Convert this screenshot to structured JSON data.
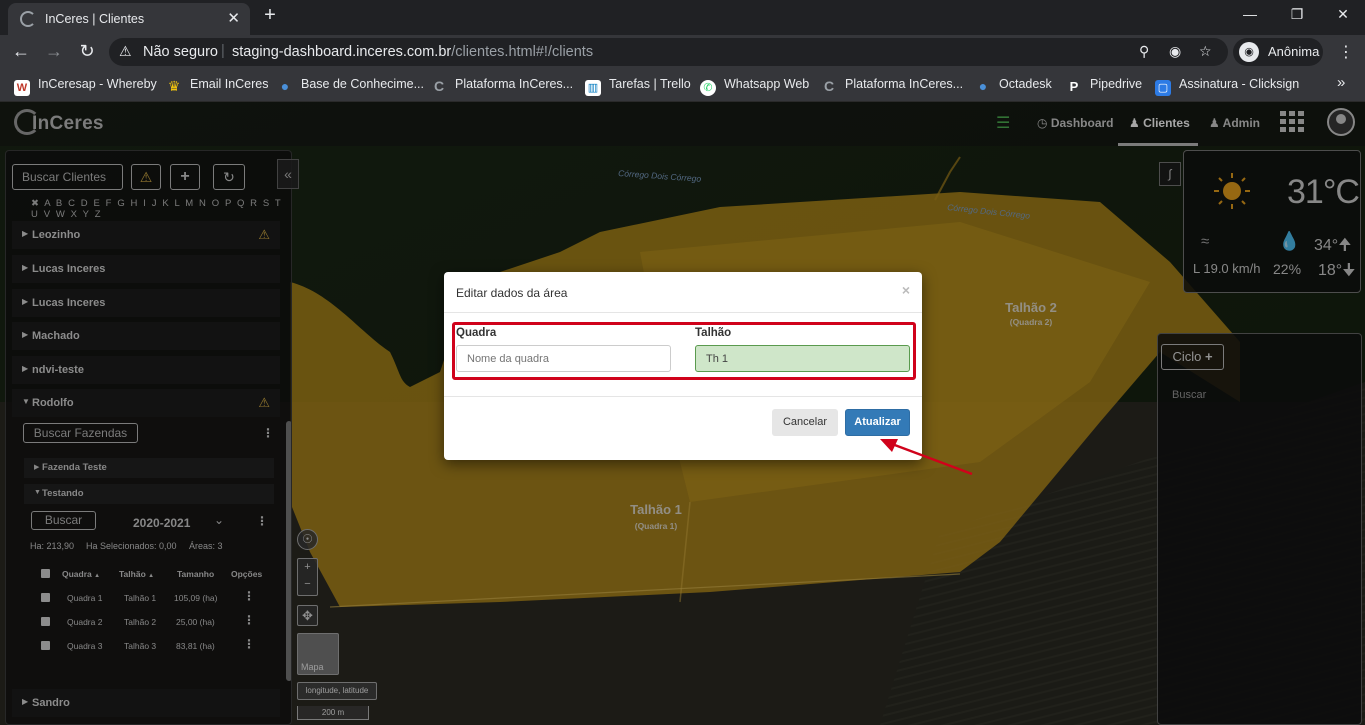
{
  "browser": {
    "tab_title": "InCeres | Clientes",
    "tab_close": "✕",
    "new_tab": "+",
    "address_security": "Não seguro",
    "address_host": "staging-dashboard.inceres.com.br",
    "address_path": "/clientes.html#!/clients",
    "profile_label": "Anônima",
    "bookmarks": [
      {
        "label": "InCeresap - Whereby",
        "icon": "W"
      },
      {
        "label": "Email InCeres",
        "icon": "♛"
      },
      {
        "label": "Base de Conhecime...",
        "icon": "●"
      },
      {
        "label": "Plataforma InCeres...",
        "icon": "C"
      },
      {
        "label": "Tarefas | Trello",
        "icon": "▥"
      },
      {
        "label": "Whatsapp Web",
        "icon": "✆"
      },
      {
        "label": "Plataforma InCeres...",
        "icon": "C"
      },
      {
        "label": "Octadesk",
        "icon": "●"
      },
      {
        "label": "Pipedrive",
        "icon": "P"
      },
      {
        "label": "Assinatura - Clicksign",
        "icon": "▢"
      }
    ],
    "bookmarks_more": "»"
  },
  "app": {
    "logo": "InCeres",
    "nav": {
      "dashboard": "Dashboard",
      "clientes": "Clientes",
      "admin": "Admin"
    }
  },
  "left_panel": {
    "search_clients_label": "Buscar Clientes",
    "alphabet": "✖ A B C D E F G H I J K L M N O P Q R S T U V W X Y Z",
    "clients": [
      {
        "name": "Leozinho",
        "warning": true
      },
      {
        "name": "Lucas Inceres",
        "warning": false
      },
      {
        "name": "Lucas Inceres",
        "warning": false
      },
      {
        "name": "Machado",
        "warning": false
      },
      {
        "name": "ndvi-teste",
        "warning": false
      },
      {
        "name": "Rodolfo",
        "warning": true
      }
    ],
    "search_farms_label": "Buscar Fazendas",
    "farms": [
      {
        "name": "Fazenda Teste"
      },
      {
        "name": "Testando"
      }
    ],
    "search_label": "Buscar",
    "season": "2020-2021",
    "summary": {
      "ha": "Ha: 213,90",
      "ha_selected": "Ha Selecionados: 0,00",
      "areas": "Áreas: 3"
    },
    "table": {
      "headers": {
        "quadra": "Quadra",
        "talhao": "Talhão",
        "tamanho": "Tamanho",
        "opcoes": "Opções"
      },
      "rows": [
        {
          "quadra": "Quadra 1",
          "talhao": "Talhão 1",
          "tamanho": "105,09 (ha)"
        },
        {
          "quadra": "Quadra 2",
          "talhao": "Talhão 2",
          "tamanho": "25,00 (ha)"
        },
        {
          "quadra": "Quadra 3",
          "talhao": "Talhão 3",
          "tamanho": "83,81 (ha)"
        }
      ]
    },
    "last_client": "Sandro"
  },
  "map": {
    "creek_label_1": "Córrego Dois Córrego",
    "creek_label_2": "Córrego Dois Córrego",
    "field_1_name": "Talhão 1",
    "field_1_sub": "(Quadra 1)",
    "field_2_name": "Talhão 2",
    "field_2_sub": "(Quadra 2)",
    "layer_label": "Mapa",
    "coords_label": "longitude, latitude",
    "scale_label": "200 m",
    "zoom_in": "+",
    "zoom_out": "−"
  },
  "weather": {
    "temperature": "31°C",
    "wind": "L 19.0 km/h",
    "humidity": "22%",
    "max": "34°",
    "min": "18°"
  },
  "ciclo_panel": {
    "button_label": "Ciclo",
    "search_label": "Buscar"
  },
  "modal": {
    "title": "Editar dados da área",
    "close": "×",
    "quadra_label": "Quadra",
    "quadra_placeholder": "Nome da quadra",
    "talhao_label": "Talhão",
    "talhao_value": "Th 1",
    "cancel_label": "Cancelar",
    "update_label": "Atualizar"
  },
  "colors": {
    "field_fill": "#c99a1c",
    "highlight_red": "#d0021b",
    "primary_blue": "#337ab7",
    "talhao_input_bg": "#cfe6c9"
  }
}
